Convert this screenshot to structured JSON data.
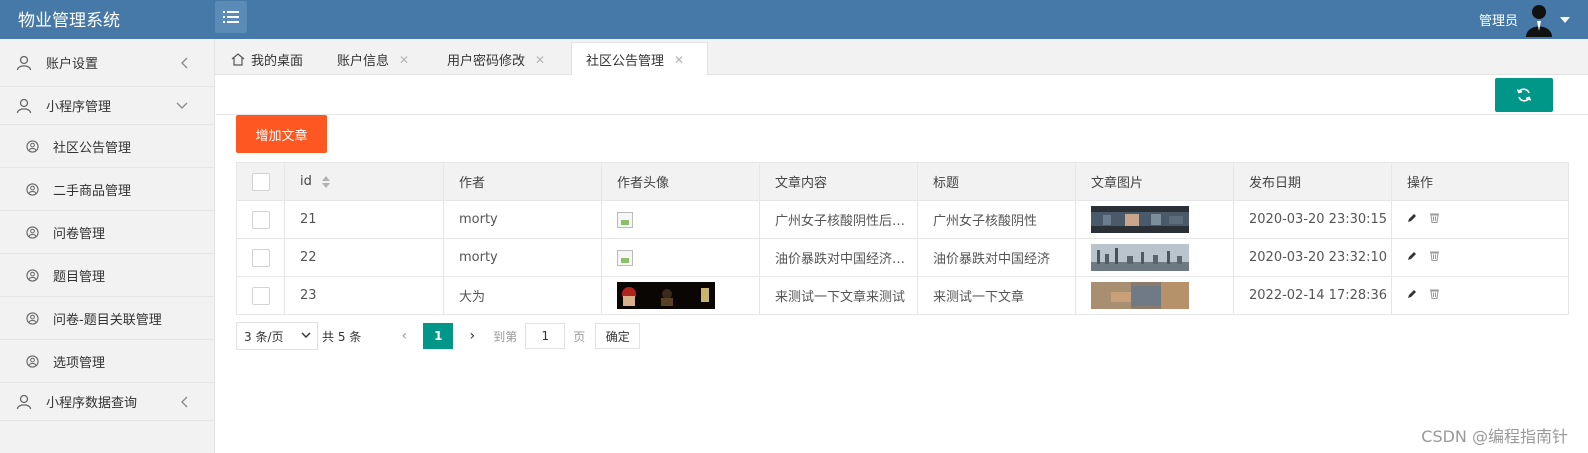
{
  "header": {
    "app_title": "物业管理系统",
    "user_label": "管理员"
  },
  "sidebar": {
    "items": [
      {
        "label": "账户设置",
        "icon": "user-icon",
        "chevron": "left"
      },
      {
        "label": "小程序管理",
        "icon": "user-icon",
        "chevron": "down"
      },
      {
        "label": "社区公告管理",
        "icon": "circle-user-icon"
      },
      {
        "label": "二手商品管理",
        "icon": "circle-user-icon"
      },
      {
        "label": "问卷管理",
        "icon": "circle-user-icon"
      },
      {
        "label": "题目管理",
        "icon": "circle-user-icon"
      },
      {
        "label": "问卷-题目关联管理",
        "icon": "circle-user-icon"
      },
      {
        "label": "选项管理",
        "icon": "circle-user-icon"
      },
      {
        "label": "小程序数据查询",
        "icon": "user-icon",
        "chevron": "left"
      }
    ]
  },
  "tabs": [
    {
      "label": "我的桌面"
    },
    {
      "label": "账户信息"
    },
    {
      "label": "用户密码修改"
    },
    {
      "label": "社区公告管理",
      "active": true
    }
  ],
  "toolbar": {
    "add_label": "增加文章"
  },
  "table": {
    "headers": [
      "id",
      "作者",
      "作者头像",
      "文章内容",
      "标题",
      "文章图片",
      "发布日期",
      "操作"
    ],
    "rows": [
      {
        "id": "21",
        "author": "morty",
        "content": "广州女子核酸阴性后确诊",
        "title": "广州女子核酸阴性",
        "date": "2020-03-20 23:30:15"
      },
      {
        "id": "22",
        "author": "morty",
        "content": "油价暴跌对中国经济影响",
        "title": "油价暴跌对中国经济",
        "date": "2020-03-20 23:32:10"
      },
      {
        "id": "23",
        "author": "大为",
        "content": "来测试一下文章来测试",
        "title": "来测试一下文章",
        "date": "2022-02-14 17:28:36"
      }
    ]
  },
  "pager": {
    "page_size": "3 条/页",
    "total": "共 5 条",
    "current": "1",
    "goto_label": "到第",
    "page_value": "1",
    "page_unit": "页",
    "confirm": "确定"
  },
  "watermark": "CSDN @编程指南针",
  "colors": {
    "header_bg": "#4679a8",
    "accent_green": "#009688",
    "add_orange": "#ff5722"
  }
}
